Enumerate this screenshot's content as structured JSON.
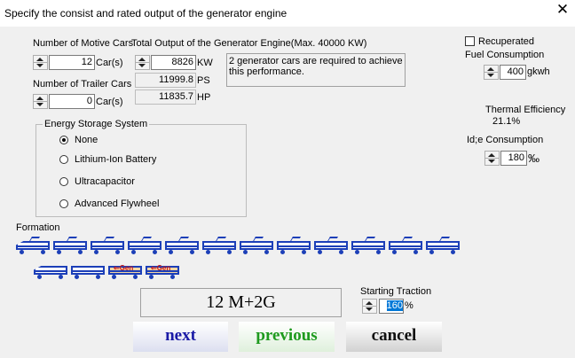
{
  "window": {
    "title": "Specify the consist and rated output of the generator engine",
    "close_glyph": "✕"
  },
  "motive_cars": {
    "label": "Number of Motive Cars",
    "value": "12",
    "unit": "Car(s)"
  },
  "trailer_cars": {
    "label": "Number of Trailer Cars",
    "value": "0",
    "unit": "Car(s)"
  },
  "generator_output": {
    "label": "Total Output of the Generator Engine(Max. 40000 KW)",
    "kw_value": "8826",
    "kw_unit": "KW",
    "ps_value": "11999.8",
    "ps_unit": "PS",
    "hp_value": "11835.7",
    "hp_unit": "HP",
    "message": "2 generator cars are required to achieve this performance."
  },
  "energy_storage": {
    "title": "Energy Storage System",
    "options": [
      {
        "label": "None",
        "selected": true
      },
      {
        "label": "Lithium-Ion Battery",
        "selected": false
      },
      {
        "label": "Ultracapacitor",
        "selected": false
      },
      {
        "label": "Advanced Flywheel",
        "selected": false
      }
    ]
  },
  "recuperated": {
    "label": "Recuperated",
    "checked": false
  },
  "fuel_consumption": {
    "label": "Fuel Consumption",
    "value": "400",
    "unit": "gkwh"
  },
  "thermal_efficiency": {
    "label": "Thermal Efficiency",
    "value": "21.1%"
  },
  "idle_consumption": {
    "label": "Id;e Consumption",
    "value": "180",
    "unit": "‰"
  },
  "formation": {
    "label": "Formation",
    "motive_car_count": 12,
    "trailer_car_count": 0,
    "generator_car_count": 2,
    "generator_tag": "Gen",
    "summary": "12 M+2G"
  },
  "starting_traction": {
    "label": "Starting Traction",
    "value": "160",
    "unit": "%"
  },
  "buttons": {
    "next": {
      "label": "next",
      "color": "#1a1aa6",
      "bg": "#dcdff0"
    },
    "previous": {
      "label": "previous",
      "color": "#1e9a1e",
      "bg": "#dff0dc"
    },
    "cancel": {
      "label": "cancel",
      "color": "#111111",
      "bg": "#d2d2d2"
    }
  }
}
